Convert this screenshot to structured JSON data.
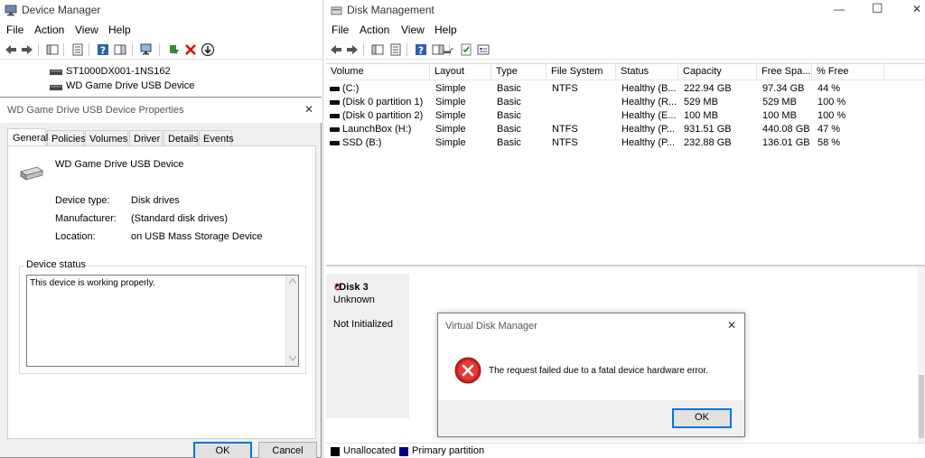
{
  "device_manager": {
    "title": "Device Manager",
    "menu": [
      "File",
      "Action",
      "View",
      "Help"
    ],
    "tree_items": [
      "ST1000DX001-1NS162",
      "WD Game Drive USB Device"
    ]
  },
  "properties": {
    "title": "WD Game Drive USB Device Properties",
    "tabs": [
      "General",
      "Policies",
      "Volumes",
      "Driver",
      "Details",
      "Events"
    ],
    "device_name": "WD Game Drive USB Device",
    "fields": [
      {
        "label": "Device type:",
        "value": "Disk drives"
      },
      {
        "label": "Manufacturer:",
        "value": "(Standard disk drives)"
      },
      {
        "label": "Location:",
        "value": "on USB Mass Storage Device"
      }
    ],
    "status_group": "Device status",
    "status_text": "This device is working properly.",
    "ok_label": "OK",
    "cancel_label": "Cancel"
  },
  "disk_management": {
    "title": "Disk Management",
    "menu": [
      "File",
      "Action",
      "View",
      "Help"
    ],
    "columns": [
      "Volume",
      "Layout",
      "Type",
      "File System",
      "Status",
      "Capacity",
      "Free Spa...",
      "% Free"
    ],
    "rows": [
      [
        "(C:)",
        "Simple",
        "Basic",
        "NTFS",
        "Healthy (B...",
        "222.94 GB",
        "97.34 GB",
        "44 %"
      ],
      [
        "(Disk 0 partition 1)",
        "Simple",
        "Basic",
        "",
        "Healthy (R...",
        "529 MB",
        "529 MB",
        "100 %"
      ],
      [
        "(Disk 0 partition 2)",
        "Simple",
        "Basic",
        "",
        "Healthy (E...",
        "100 MB",
        "100 MB",
        "100 %"
      ],
      [
        "LaunchBox (H:)",
        "Simple",
        "Basic",
        "NTFS",
        "Healthy (P...",
        "931.51 GB",
        "440.08 GB",
        "47 %"
      ],
      [
        "SSD (B:)",
        "Simple",
        "Basic",
        "NTFS",
        "Healthy (P...",
        "232.88 GB",
        "136.01 GB",
        "58 %"
      ]
    ],
    "disk": {
      "name": "*Disk 3",
      "type": "Unknown",
      "state": "Not Initialized"
    },
    "legend": [
      {
        "label": "Unallocated",
        "color": "#000000"
      },
      {
        "label": "Primary partition",
        "color": "#000080"
      }
    ]
  },
  "error_dialog": {
    "title": "Virtual Disk Manager",
    "message": "The request failed due to a fatal device hardware error.",
    "ok_label": "OK"
  },
  "window_controls": {
    "minimize": "—",
    "maximize": "☐",
    "close": "✕"
  }
}
